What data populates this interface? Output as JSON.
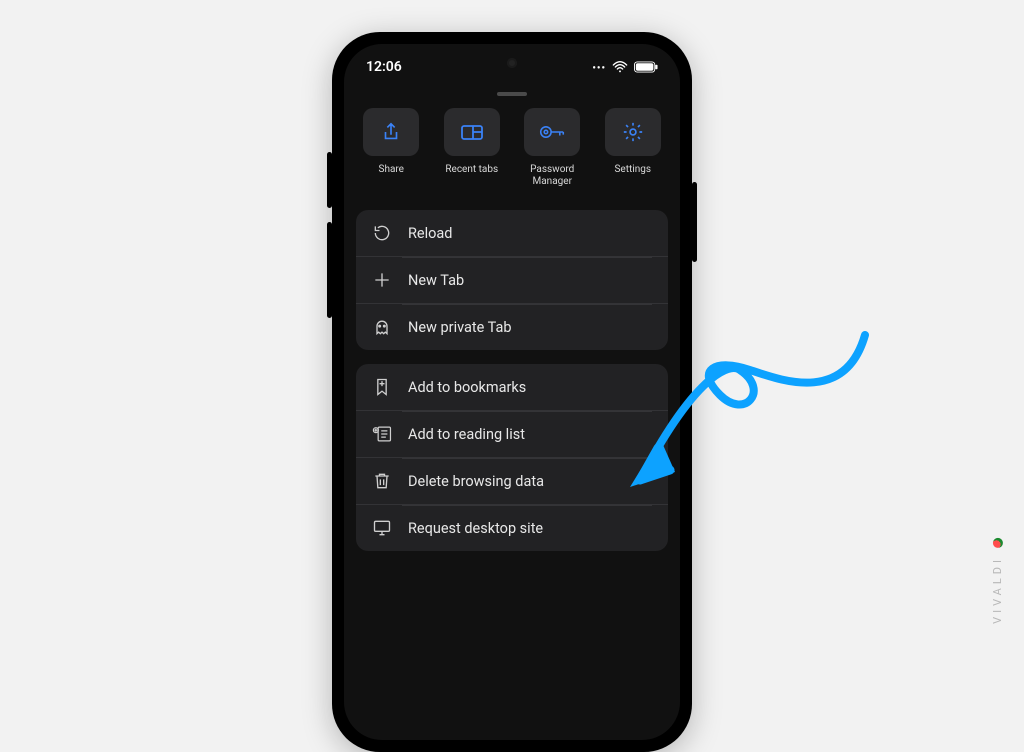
{
  "status": {
    "time": "12:06"
  },
  "quick": [
    {
      "label": "Share",
      "icon": "share-icon"
    },
    {
      "label": "Recent tabs",
      "icon": "recent-tabs-icon"
    },
    {
      "label": "Password Manager",
      "icon": "password-manager-icon"
    },
    {
      "label": "Settings",
      "icon": "settings-icon"
    }
  ],
  "group1": [
    {
      "label": "Reload",
      "icon": "reload-icon"
    },
    {
      "label": "New Tab",
      "icon": "plus-icon"
    },
    {
      "label": "New private Tab",
      "icon": "ghost-icon"
    }
  ],
  "group2": [
    {
      "label": "Add to bookmarks",
      "icon": "bookmark-add-icon"
    },
    {
      "label": "Add to reading list",
      "icon": "reading-list-add-icon"
    },
    {
      "label": "Delete browsing data",
      "icon": "trash-icon"
    },
    {
      "label": "Request desktop site",
      "icon": "monitor-icon"
    }
  ],
  "brand": "VIVALDI",
  "colors": {
    "accent": "#3a82f7",
    "arrow": "#0da2ff"
  }
}
